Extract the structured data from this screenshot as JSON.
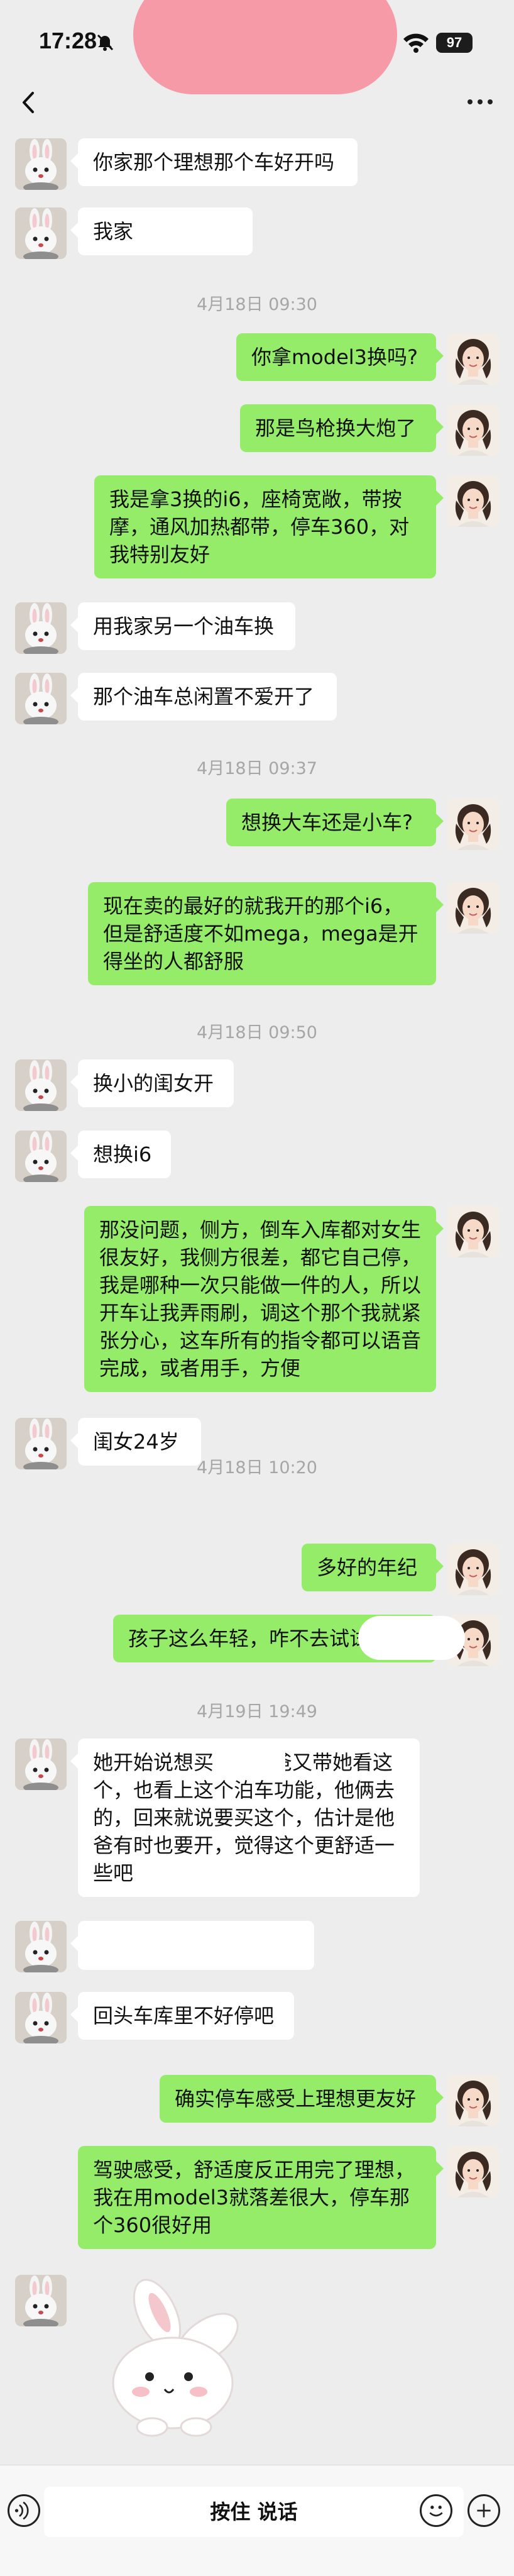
{
  "status_bar": {
    "time": "17:28",
    "battery": "97"
  },
  "timestamps": [
    "4月18日 09:30",
    "4月18日 09:37",
    "4月18日 09:50",
    "4月18日 10:20",
    "4月19日 19:49"
  ],
  "messages": [
    {
      "side": "left",
      "text": "你家那个理想那个车好开吗"
    },
    {
      "side": "left",
      "text": "我家"
    },
    {
      "side": "right",
      "text": "你拿model3换吗?"
    },
    {
      "side": "right",
      "text": "那是鸟枪换大炮了"
    },
    {
      "side": "right",
      "text": "我是拿3换的i6，座椅宽敞，带按摩，通风加热都带，停车360，对我特别友好"
    },
    {
      "side": "left",
      "text": "用我家另一个油车换"
    },
    {
      "side": "left",
      "text": "那个油车总闲置不爱开了"
    },
    {
      "side": "right",
      "text": "想换大车还是小车?"
    },
    {
      "side": "right",
      "text": "现在卖的最好的就我开的那个i6，但是舒适度不如mega，mega是开得坐的人都舒服"
    },
    {
      "side": "left",
      "text": "换小的闺女开"
    },
    {
      "side": "left",
      "text": "想换i6"
    },
    {
      "side": "right",
      "text": "那没问题，侧方，倒车入库都对女生很友好，我侧方很差，都它自己停，我是哪种一次只能做一件的人，所以开车让我弄雨刷，调这个那个我就紧张分心，这车所有的指令都可以语音完成，或者用手，方便"
    },
    {
      "side": "left",
      "text": "闺女24岁"
    },
    {
      "side": "right",
      "text": "多好的年纪"
    },
    {
      "side": "right",
      "text": "孩子这么年轻，咋不去试试"
    },
    {
      "side": "left",
      "text": "她开始说想买      他爸又带她看这个，也看上这个泊车功能，他俩去的，回来就说要买这个，估计是他爸有时也要开，觉得这个更舒适一些吧"
    },
    {
      "side": "left",
      "text": ""
    },
    {
      "side": "left",
      "text": "回头车库里不好停吧"
    },
    {
      "side": "right",
      "text": "确实停车感受上理想更友好"
    },
    {
      "side": "right",
      "text": "驾驶感受，舒适度反正用完了理想，我在用model3就落差很大，停车那个360很好用"
    }
  ],
  "input_bar": {
    "voice_label": "按住 说话",
    "voice_icon": "voice-icon",
    "emoji_icon": "emoji-icon",
    "plus_icon": "plus-icon"
  },
  "colors": {
    "background": "#ededed",
    "outgoing_bubble": "#95ec69",
    "incoming_bubble": "#ffffff",
    "timestamp": "#a6a6a6"
  }
}
